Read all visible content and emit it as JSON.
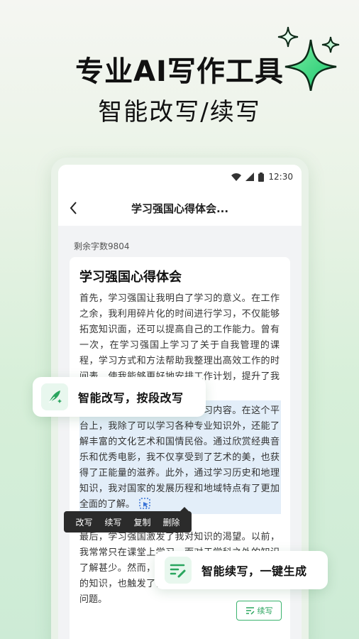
{
  "headline": {
    "title": "专业AI写作工具",
    "subtitle": "智能改写/续写"
  },
  "statusbar": {
    "time": "12:30"
  },
  "nav": {
    "title": "学习强国心得体会..."
  },
  "editor": {
    "remaining": "剩余字数9804",
    "doc_title": "学习强国心得体会",
    "para1": "首先，学习强国让我明白了学习的意义。在工作之余，我利用碎片化的时间进行学习，不仅能够拓宽知识面，还可以提高自己的工作能力。曾有一次，在学习强国上学习了关于自我管理的课程，学习方式和方法帮助我整理出高效工作的时间表，使我能够更好地安排工作计划，提升了我的工作效率。",
    "para2": "其次，学习强国丰富了我的学习内容。在这个平台上，我除了可以学习各种专业知识外，还能了解丰富的文化艺术和国情民俗。通过欣赏经典音乐和优秀电影，我不仅享受到了艺术的美，也获得了正能量的滋养。此外，通过学习历史和地理知识，我对国家的发展历程和地域特点有了更加全面的了解。",
    "para3": "最后，学习强国激发了我对知识的渴望。以前，我常常只在课堂上学习，而对于学科之外的知识了解甚少。然而，学习强国让我接触到了许多新的知识，也触发了我对知识的兴趣，去探索更多问题。",
    "continue_label": "续写"
  },
  "context_menu": [
    "改写",
    "续写",
    "复制",
    "删除"
  ],
  "callouts": {
    "rewrite": "智能改写，按段改写",
    "continue": "智能续写，一键生成"
  },
  "colors": {
    "accent": "#2aa55e",
    "selection": "#e3eef9"
  },
  "icons": {
    "rewrite": "feather-sparkle-icon",
    "continue": "lines-pen-icon",
    "cursor": "cursor-select-icon"
  }
}
